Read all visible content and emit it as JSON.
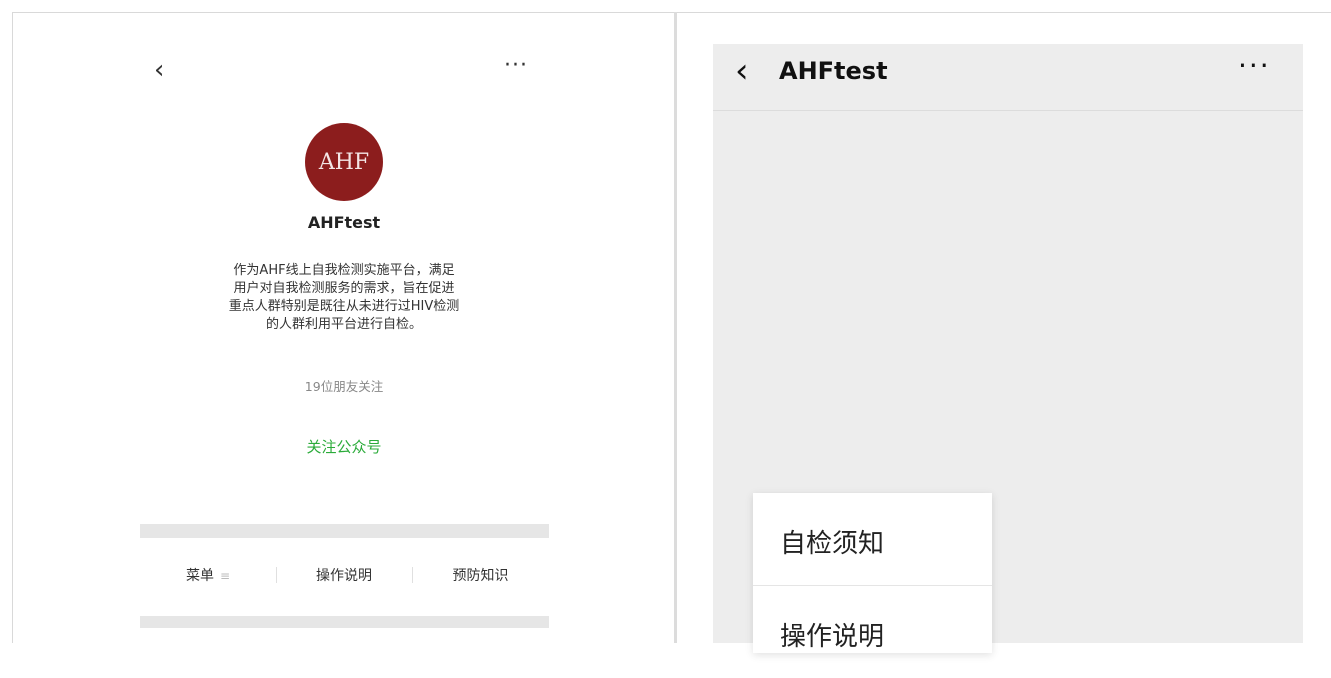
{
  "left_panel": {
    "back_icon": "‹",
    "more_icon": "···",
    "logo_text": "AHF",
    "account_name": "AHFtest",
    "description": [
      "作为AHF线上自我检测实施平台，满足",
      "用户对自我检测服务的需求，旨在促进",
      "重点人群特别是既往从未进行过HIV检测",
      "的人群利用平台进行自检。"
    ],
    "friends_following": "19位朋友关注",
    "follow_button": "关注公众号",
    "menu": [
      {
        "label": "菜单",
        "icon": "≡"
      },
      {
        "label": "操作说明"
      },
      {
        "label": "预防知识"
      }
    ]
  },
  "right_panel": {
    "back_icon": "‹",
    "title": "AHFtest",
    "more_icon": "···",
    "popup_menu": [
      {
        "label": "自检须知"
      },
      {
        "label": "操作说明"
      }
    ]
  },
  "colors": {
    "logo_bg": "#8c1d1d",
    "follow_green": "#2bab3a",
    "right_bg": "#ededed"
  }
}
